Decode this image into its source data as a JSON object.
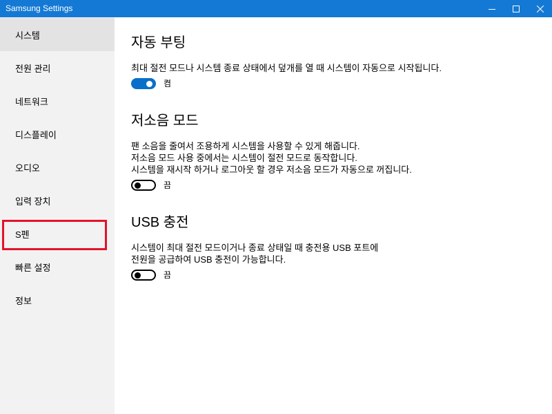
{
  "window": {
    "title": "Samsung Settings",
    "controls": [
      "minimize-icon",
      "maximize-icon",
      "close-icon"
    ]
  },
  "sidebar": {
    "items": [
      {
        "label": "시스템",
        "selected": true
      },
      {
        "label": "전원 관리",
        "selected": false
      },
      {
        "label": "네트워크",
        "selected": false
      },
      {
        "label": "디스플레이",
        "selected": false
      },
      {
        "label": "오디오",
        "selected": false
      },
      {
        "label": "입력 장치",
        "selected": false
      },
      {
        "label": "S펜",
        "selected": false,
        "highlighted": true
      },
      {
        "label": "빠른 설정",
        "selected": false
      },
      {
        "label": "정보",
        "selected": false
      }
    ]
  },
  "sections": [
    {
      "title": "자동 부팅",
      "description": [
        "최대 절전 모드나 시스템 종료 상태에서 덮개를 열 때 시스템이 자동으로 시작됩니다."
      ],
      "toggle": {
        "on": true,
        "label": "켬"
      }
    },
    {
      "title": "저소음 모드",
      "description": [
        "팬 소음을 줄여서 조용하게 시스템을 사용할 수 있게 해줍니다.",
        "저소음 모드 사용 중에서는 시스템이 절전 모드로 동작합니다.",
        "시스템을 재시작 하거나 로그아웃 할 경우 저소음 모드가 자동으로 꺼집니다."
      ],
      "toggle": {
        "on": false,
        "label": "끔"
      }
    },
    {
      "title": "USB 충전",
      "description": [
        "시스템이 최대 절전 모드이거나 종료 상태일 때 충전용 USB 포트에",
        "전원을 공급하여 USB 충전이 가능합니다."
      ],
      "toggle": {
        "on": false,
        "label": "끔"
      }
    }
  ],
  "colors": {
    "titlebar": "#1479d4",
    "accent": "#0a6fc9",
    "highlight": "#e3122b",
    "sidebar_bg": "#f2f2f2",
    "sidebar_selected": "#e3e3e3"
  }
}
